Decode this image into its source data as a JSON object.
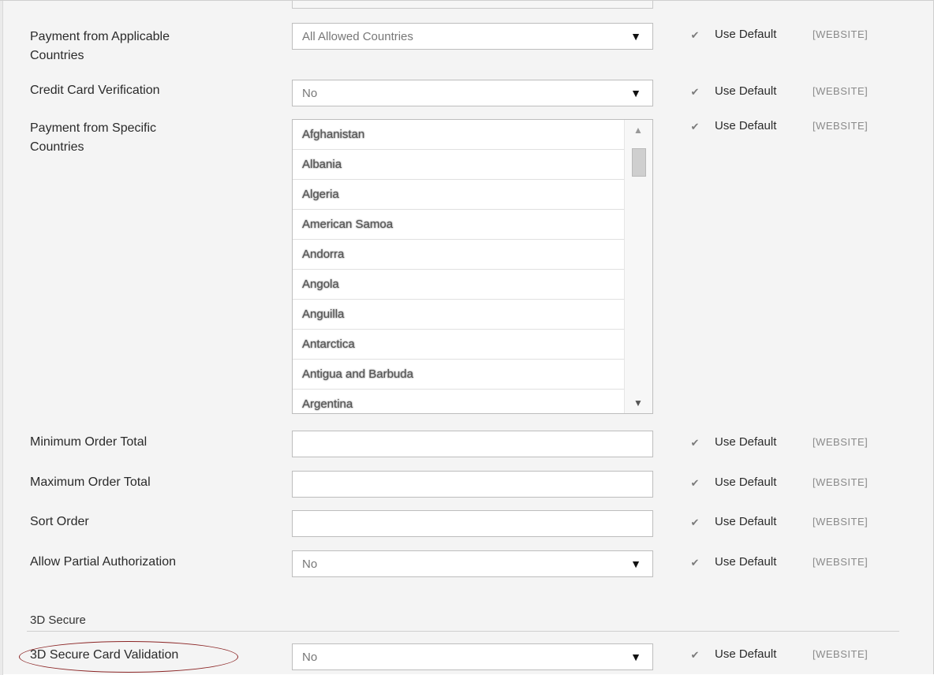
{
  "rows": [
    {
      "label": "Payment from Applicable\nCountries",
      "type": "select",
      "value": "All Allowed Countries",
      "use_default": "Use Default",
      "scope": "[WEBSITE]"
    },
    {
      "label": "Credit Card Verification",
      "type": "select",
      "value": "No",
      "use_default": "Use Default",
      "scope": "[WEBSITE]"
    },
    {
      "label": "Payment from Specific\nCountries",
      "type": "multiselect",
      "use_default": "Use Default",
      "scope": "[WEBSITE]"
    },
    {
      "label": "Minimum Order Total",
      "type": "input",
      "value": "",
      "use_default": "Use Default",
      "scope": "[WEBSITE]"
    },
    {
      "label": "Maximum Order Total",
      "type": "input",
      "value": "",
      "use_default": "Use Default",
      "scope": "[WEBSITE]"
    },
    {
      "label": "Sort Order",
      "type": "input",
      "value": "",
      "use_default": "Use Default",
      "scope": "[WEBSITE]"
    },
    {
      "label": "Allow Partial Authorization",
      "type": "select",
      "value": "No",
      "use_default": "Use Default",
      "scope": "[WEBSITE]"
    },
    {
      "label": "3D Secure Card Validation",
      "type": "select",
      "value": "No",
      "use_default": "Use Default",
      "scope": "[WEBSITE]"
    }
  ],
  "countries": [
    "Afghanistan",
    "Albania",
    "Algeria",
    "American Samoa",
    "Andorra",
    "Angola",
    "Anguilla",
    "Antarctica",
    "Antigua and Barbuda",
    "Argentina"
  ],
  "section_title": "3D Secure",
  "glyphs": {
    "checkbox": "✔",
    "dropdown_arrow": "▼",
    "scroll_up": "▲",
    "scroll_down": "▼"
  },
  "colors": {
    "highlight_ellipse": "#8b2525",
    "background": "#f4f4f4"
  }
}
